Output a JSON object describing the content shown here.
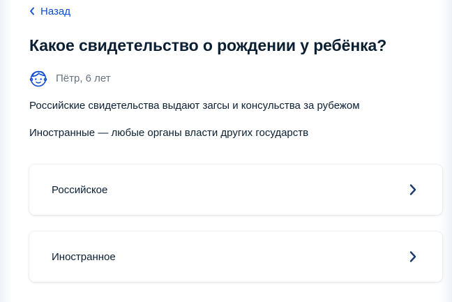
{
  "nav": {
    "back_label": "Назад"
  },
  "question": {
    "title": "Какое свидетельство о рождении у ребёнка?"
  },
  "child": {
    "name": "Пётр, 6 лет"
  },
  "hints": [
    "Российские свидетельства выдают загсы и консульства за рубежом",
    "Иностранные — любые органы власти других государств"
  ],
  "options": [
    {
      "label": "Российское",
      "icon": "chevron-right-icon"
    },
    {
      "label": "Иностранное",
      "icon": "chevron-right-icon"
    }
  ],
  "colors": {
    "accent": "#0d4cd3",
    "text": "#0b1f33",
    "secondary_text": "#66727f",
    "chevron": "#1c3c6e"
  }
}
